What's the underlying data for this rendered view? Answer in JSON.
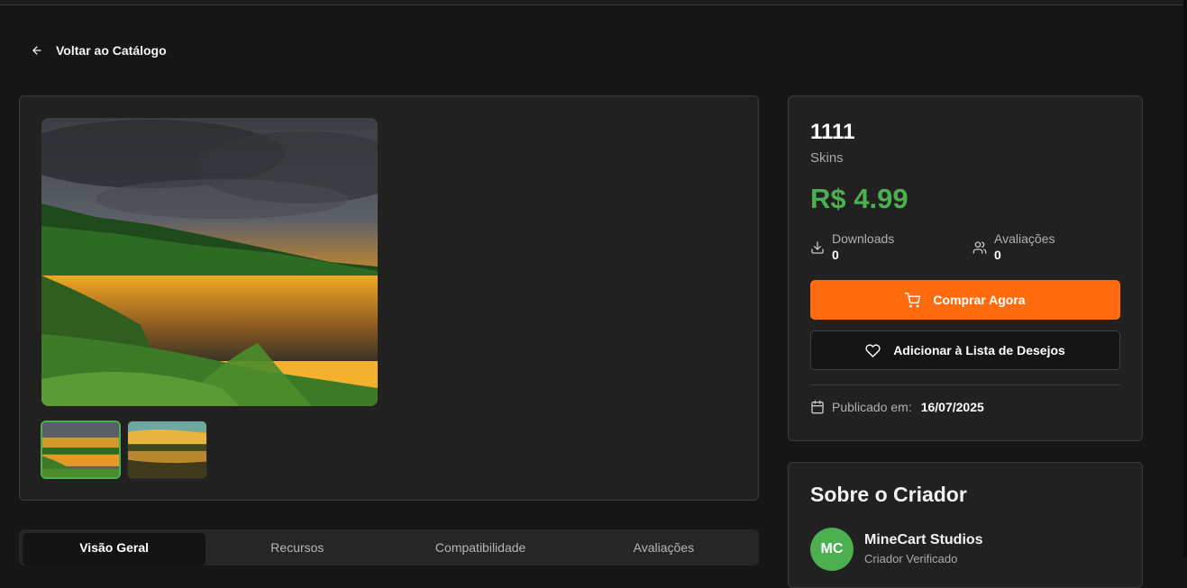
{
  "navigation": {
    "back_label": "Voltar ao Catálogo"
  },
  "gallery": {
    "main_image": "sunset-lake-landscape",
    "thumbnails": [
      {
        "image": "sunset-lake-landscape",
        "selected": true
      },
      {
        "image": "sunset-river-landscape",
        "selected": false
      }
    ]
  },
  "tabs": [
    {
      "label": "Visão Geral",
      "active": true
    },
    {
      "label": "Recursos",
      "active": false
    },
    {
      "label": "Compatibilidade",
      "active": false
    },
    {
      "label": "Avaliações",
      "active": false
    }
  ],
  "product": {
    "title": "1111",
    "category": "Skins",
    "price": "R$ 4.99",
    "stats": {
      "downloads": {
        "label": "Downloads",
        "value": "0",
        "icon": "download-icon"
      },
      "reviews": {
        "label": "Avaliações",
        "value": "0",
        "icon": "users-icon"
      }
    },
    "buy_label": "Comprar Agora",
    "wishlist_label": "Adicionar à Lista de Desejos",
    "published_label": "Publicado em:",
    "published_date": "16/07/2025"
  },
  "creator": {
    "section_title": "Sobre o Criador",
    "initials": "MC",
    "name": "MineCart Studios",
    "subtitle": "Criador Verificado"
  },
  "colors": {
    "accent_green": "#4caf50",
    "buy_orange": "#ff6b0f",
    "background": "#161616",
    "card": "#212121"
  }
}
